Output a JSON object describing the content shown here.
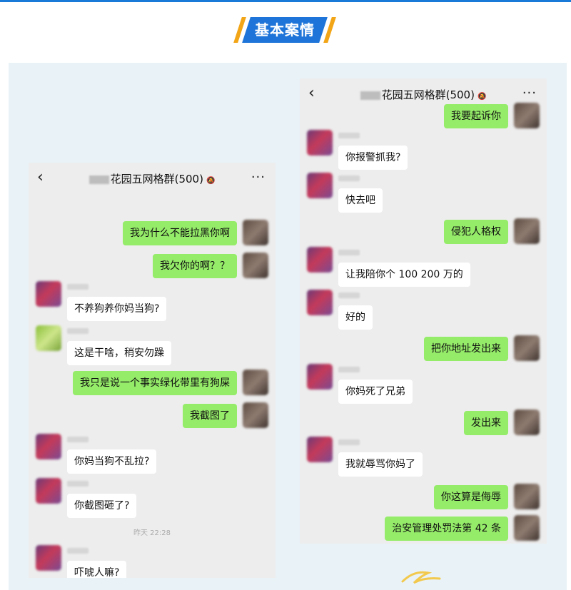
{
  "header": {
    "title": "基本案情"
  },
  "left_phone": {
    "title": "花园五网格群(500)",
    "messages": [
      {
        "side": "out",
        "text": "我为什么不能拉黑你啊"
      },
      {
        "side": "out",
        "text": "我欠你的啊？？"
      },
      {
        "side": "in",
        "text": "不养狗养你妈当狗?"
      },
      {
        "side": "in",
        "text": "这是干啥，稍安勿躁"
      },
      {
        "side": "out",
        "text": "我只是说一个事实绿化带里有狗屎"
      },
      {
        "side": "out",
        "text": "我截图了"
      },
      {
        "side": "in",
        "text": "你妈当狗不乱拉?"
      },
      {
        "side": "in",
        "text": "你截图砸了?"
      },
      {
        "side": "time",
        "text": "昨天 22:28"
      },
      {
        "side": "in",
        "text": "吓唬人嘛?"
      }
    ]
  },
  "right_phone": {
    "title": "花园五网格群(500)",
    "messages": [
      {
        "side": "out",
        "text": "我要起诉你"
      },
      {
        "side": "in",
        "text": "你报警抓我?"
      },
      {
        "side": "in",
        "text": "快去吧"
      },
      {
        "side": "out",
        "text": "侵犯人格权"
      },
      {
        "side": "in",
        "text": "让我陪你个 100 200 万的"
      },
      {
        "side": "in",
        "text": "好的"
      },
      {
        "side": "out",
        "text": "把你地址发出来"
      },
      {
        "side": "in",
        "text": "你妈死了兄弟"
      },
      {
        "side": "out",
        "text": "发出来"
      },
      {
        "side": "in",
        "text": "我就辱骂你妈了"
      },
      {
        "side": "out",
        "text": "你这算是侮辱"
      },
      {
        "side": "out",
        "text": "治安管理处罚法第 42 条"
      }
    ]
  },
  "colors": {
    "accent": "#1e74d8",
    "accent2": "#f2a516",
    "bubble_out": "#95ec69",
    "panel_bg": "#e9f2f7"
  }
}
